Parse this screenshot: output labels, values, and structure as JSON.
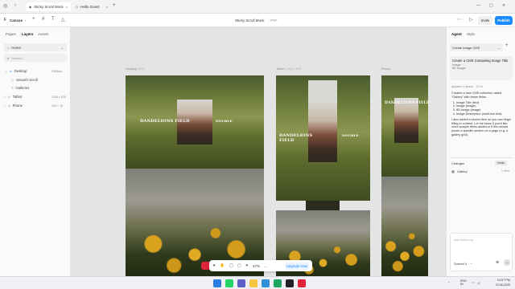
{
  "browser": {
    "tabs": [
      {
        "label": "Sticky Scroll Mock"
      },
      {
        "label": "Hello Guest"
      }
    ]
  },
  "toolbar": {
    "app_name": "Canvas",
    "doc_title": "Sticky Scroll Mock",
    "doc_badge": "/ page",
    "invite_label": "Invite",
    "publish_label": "Publish"
  },
  "left_panel": {
    "tabs": [
      "Pages",
      "Layers",
      "Assets"
    ],
    "page_select": "Home",
    "search_placeholder": "Search...",
    "layers": [
      {
        "label": "Desktop",
        "meta": "Fill/Auto",
        "indent": 0
      },
      {
        "label": "Smooth Scroll",
        "meta": "",
        "indent": 1
      },
      {
        "label": "Galleries",
        "meta": "",
        "indent": 1
      },
      {
        "label": "Tablet",
        "meta": "1200 × 810",
        "indent": 0
      },
      {
        "label": "Phone",
        "meta": "390 × 10",
        "indent": 0
      }
    ]
  },
  "canvas": {
    "frames": [
      {
        "label": "Desktop",
        "meta": "1200"
      },
      {
        "label": "Tablet",
        "meta": "1,200 × 810"
      },
      {
        "label": "Phone",
        "meta": ""
      }
    ],
    "overlay_left": "DANDELIONS FIELD",
    "overlay_right": "DOUBLE",
    "zoom": "47%",
    "upgrade_label": "Upgrade Now"
  },
  "right_panel": {
    "tabs": [
      "Agent",
      "Style"
    ],
    "task_select": "Create Image CMS",
    "card_title": "Create a CMS Containing Image Title",
    "card_sub1": "Image",
    "card_sub2": "8D Image",
    "applied": "Applied 4 layers · 13 m",
    "intro": "Created a new CMS collection called \"Gallery\" with these fields:",
    "fields": [
      "Image Title (text)",
      "Image (image)",
      "8D Image (image)",
      "Image Description (multi-line text)"
    ],
    "body": "I also added a stories item so you can begin filling in content. Let me know if you'd like more sample items added or if this should power a specific section on a page (e.g. a gallery grid).",
    "changes_label": "Changes",
    "changes_badge": "Undo",
    "changes_item": "Gallery",
    "changes_count": "1 Item",
    "followup_placeholder": "Ask follow-up...",
    "model": "Sonnet 4"
  },
  "taskbar": {
    "lang": "ENG\nIN",
    "time": "10:07 PM",
    "date": "23-08-2025"
  },
  "colors": {
    "publish": "#1b8cff",
    "upgrade": "#1b8cff",
    "accent_red": "#e0223a"
  }
}
